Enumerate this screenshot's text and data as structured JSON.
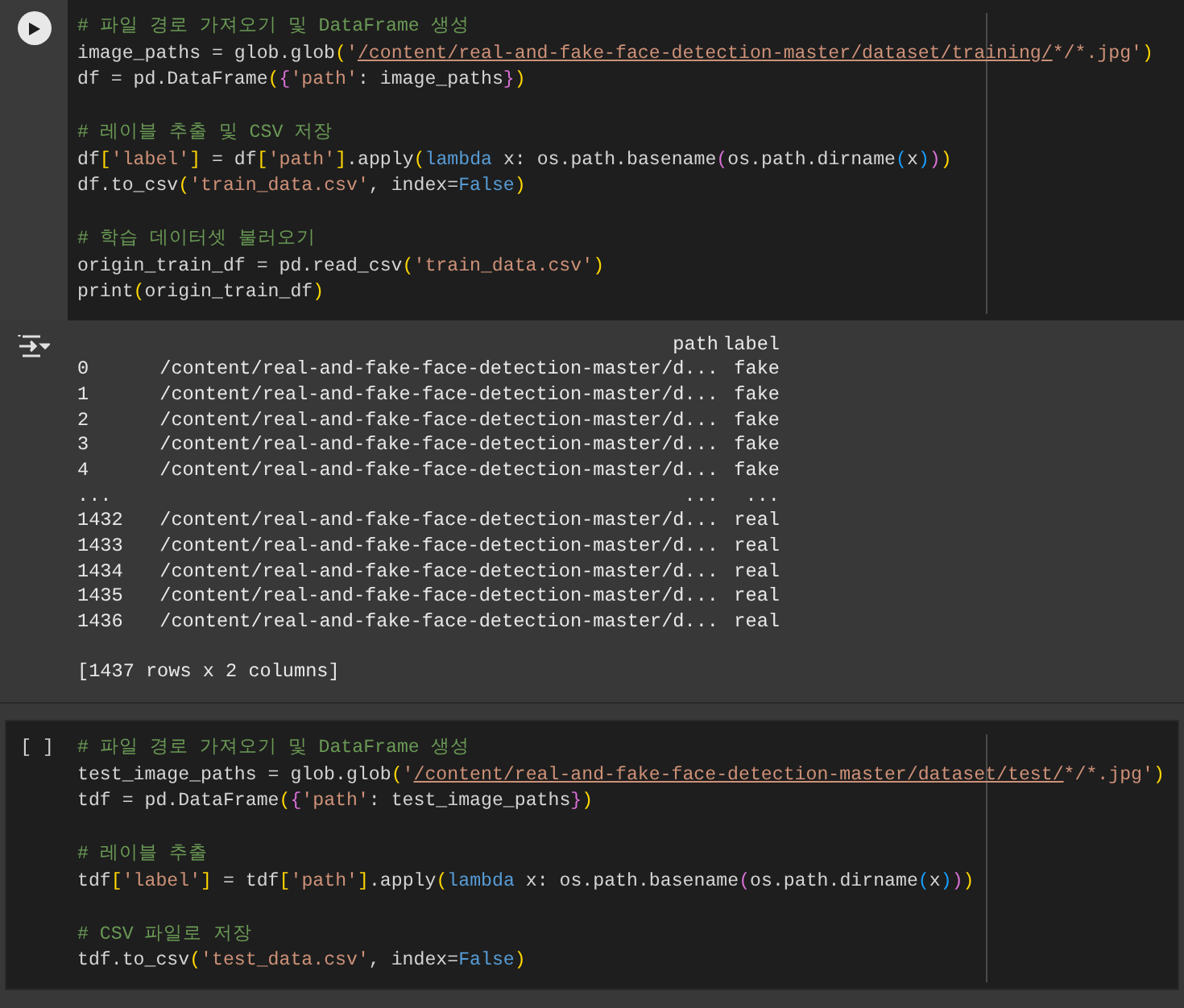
{
  "cells": [
    {
      "kind": "run",
      "blocks": [
        [
          [
            {
              "kind": "comment",
              "text": "# 파일 경로 가져오기 및 DataFrame 생성"
            }
          ],
          [
            {
              "kind": "text",
              "text": "image_paths = glob.glob"
            },
            {
              "kind": "b1",
              "text": "("
            },
            {
              "kind": "string",
              "text": "'"
            },
            {
              "kind": "link",
              "text": "/content/real-and-fake-face-detection-master/dataset/training/"
            },
            {
              "kind": "string",
              "text": "*/*.jpg'"
            },
            {
              "kind": "b1",
              "text": ")"
            }
          ],
          [
            {
              "kind": "text",
              "text": "df = pd.DataFrame"
            },
            {
              "kind": "b1",
              "text": "("
            },
            {
              "kind": "b2",
              "text": "{"
            },
            {
              "kind": "string",
              "text": "'path'"
            },
            {
              "kind": "text",
              "text": ": image_paths"
            },
            {
              "kind": "b2",
              "text": "}"
            },
            {
              "kind": "b1",
              "text": ")"
            }
          ]
        ],
        [
          [
            {
              "kind": "comment",
              "text": "# 레이블 추출 및 CSV 저장"
            }
          ],
          [
            {
              "kind": "text",
              "text": "df"
            },
            {
              "kind": "b1",
              "text": "["
            },
            {
              "kind": "string",
              "text": "'label'"
            },
            {
              "kind": "b1",
              "text": "]"
            },
            {
              "kind": "text",
              "text": " = df"
            },
            {
              "kind": "b1",
              "text": "["
            },
            {
              "kind": "string",
              "text": "'path'"
            },
            {
              "kind": "b1",
              "text": "]"
            },
            {
              "kind": "text",
              "text": ".apply"
            },
            {
              "kind": "b1",
              "text": "("
            },
            {
              "kind": "keyword",
              "text": "lambda"
            },
            {
              "kind": "text",
              "text": " x: os.path.basename"
            },
            {
              "kind": "b2",
              "text": "("
            },
            {
              "kind": "text",
              "text": "os.path.dirname"
            },
            {
              "kind": "b3",
              "text": "("
            },
            {
              "kind": "text",
              "text": "x"
            },
            {
              "kind": "b3",
              "text": ")"
            },
            {
              "kind": "b2",
              "text": ")"
            },
            {
              "kind": "b1",
              "text": ")"
            }
          ],
          [
            {
              "kind": "text",
              "text": "df.to_csv"
            },
            {
              "kind": "b1",
              "text": "("
            },
            {
              "kind": "string",
              "text": "'train_data.csv'"
            },
            {
              "kind": "text",
              "text": ", index="
            },
            {
              "kind": "keyword",
              "text": "False"
            },
            {
              "kind": "b1",
              "text": ")"
            }
          ]
        ],
        [
          [
            {
              "kind": "comment",
              "text": "# 학습 데이터셋 불러오기"
            }
          ],
          [
            {
              "kind": "text",
              "text": "origin_train_df = pd.read_csv"
            },
            {
              "kind": "b1",
              "text": "("
            },
            {
              "kind": "string",
              "text": "'train_data.csv'"
            },
            {
              "kind": "b1",
              "text": ")"
            }
          ],
          [
            {
              "kind": "text",
              "text": "print"
            },
            {
              "kind": "b1",
              "text": "("
            },
            {
              "kind": "text",
              "text": "origin_train_df"
            },
            {
              "kind": "b1",
              "text": ")"
            }
          ]
        ]
      ],
      "output": {
        "header": [
          "path",
          "label"
        ],
        "rows": [
          {
            "index": "0",
            "path": "/content/real-and-fake-face-detection-master/d...",
            "label": "fake"
          },
          {
            "index": "1",
            "path": "/content/real-and-fake-face-detection-master/d...",
            "label": "fake"
          },
          {
            "index": "2",
            "path": "/content/real-and-fake-face-detection-master/d...",
            "label": "fake"
          },
          {
            "index": "3",
            "path": "/content/real-and-fake-face-detection-master/d...",
            "label": "fake"
          },
          {
            "index": "4",
            "path": "/content/real-and-fake-face-detection-master/d...",
            "label": "fake"
          },
          {
            "index": "...",
            "path": "...",
            "label": "..."
          },
          {
            "index": "1432",
            "path": "/content/real-and-fake-face-detection-master/d...",
            "label": "real"
          },
          {
            "index": "1433",
            "path": "/content/real-and-fake-face-detection-master/d...",
            "label": "real"
          },
          {
            "index": "1434",
            "path": "/content/real-and-fake-face-detection-master/d...",
            "label": "real"
          },
          {
            "index": "1435",
            "path": "/content/real-and-fake-face-detection-master/d...",
            "label": "real"
          },
          {
            "index": "1436",
            "path": "/content/real-and-fake-face-detection-master/d...",
            "label": "real"
          }
        ],
        "footer": "[1437 rows x 2 columns]"
      }
    },
    {
      "kind": "idle",
      "prompt": "[ ]",
      "blocks": [
        [
          [
            {
              "kind": "comment",
              "text": "# 파일 경로 가져오기 및 DataFrame 생성"
            }
          ],
          [
            {
              "kind": "text",
              "text": "test_image_paths = glob.glob"
            },
            {
              "kind": "b1",
              "text": "("
            },
            {
              "kind": "string",
              "text": "'"
            },
            {
              "kind": "link",
              "text": "/content/real-and-fake-face-detection-master/dataset/test/"
            },
            {
              "kind": "string",
              "text": "*/*.jpg'"
            },
            {
              "kind": "b1",
              "text": ")"
            }
          ],
          [
            {
              "kind": "text",
              "text": "tdf = pd.DataFrame"
            },
            {
              "kind": "b1",
              "text": "("
            },
            {
              "kind": "b2",
              "text": "{"
            },
            {
              "kind": "string",
              "text": "'path'"
            },
            {
              "kind": "text",
              "text": ": test_image_paths"
            },
            {
              "kind": "b2",
              "text": "}"
            },
            {
              "kind": "b1",
              "text": ")"
            }
          ]
        ],
        [
          [
            {
              "kind": "comment",
              "text": "# 레이블 추출"
            }
          ],
          [
            {
              "kind": "text",
              "text": "tdf"
            },
            {
              "kind": "b1",
              "text": "["
            },
            {
              "kind": "string",
              "text": "'label'"
            },
            {
              "kind": "b1",
              "text": "]"
            },
            {
              "kind": "text",
              "text": " = tdf"
            },
            {
              "kind": "b1",
              "text": "["
            },
            {
              "kind": "string",
              "text": "'path'"
            },
            {
              "kind": "b1",
              "text": "]"
            },
            {
              "kind": "text",
              "text": ".apply"
            },
            {
              "kind": "b1",
              "text": "("
            },
            {
              "kind": "keyword",
              "text": "lambda"
            },
            {
              "kind": "text",
              "text": " x: os.path.basename"
            },
            {
              "kind": "b2",
              "text": "("
            },
            {
              "kind": "text",
              "text": "os.path.dirname"
            },
            {
              "kind": "b3",
              "text": "("
            },
            {
              "kind": "text",
              "text": "x"
            },
            {
              "kind": "b3",
              "text": ")"
            },
            {
              "kind": "b2",
              "text": ")"
            },
            {
              "kind": "b1",
              "text": ")"
            }
          ]
        ],
        [
          [
            {
              "kind": "comment",
              "text": "# CSV 파일로 저장"
            }
          ],
          [
            {
              "kind": "text",
              "text": "tdf.to_csv"
            },
            {
              "kind": "b1",
              "text": "("
            },
            {
              "kind": "string",
              "text": "'test_data.csv'"
            },
            {
              "kind": "text",
              "text": ", index="
            },
            {
              "kind": "keyword",
              "text": "False"
            },
            {
              "kind": "b1",
              "text": ")"
            }
          ]
        ]
      ]
    }
  ]
}
